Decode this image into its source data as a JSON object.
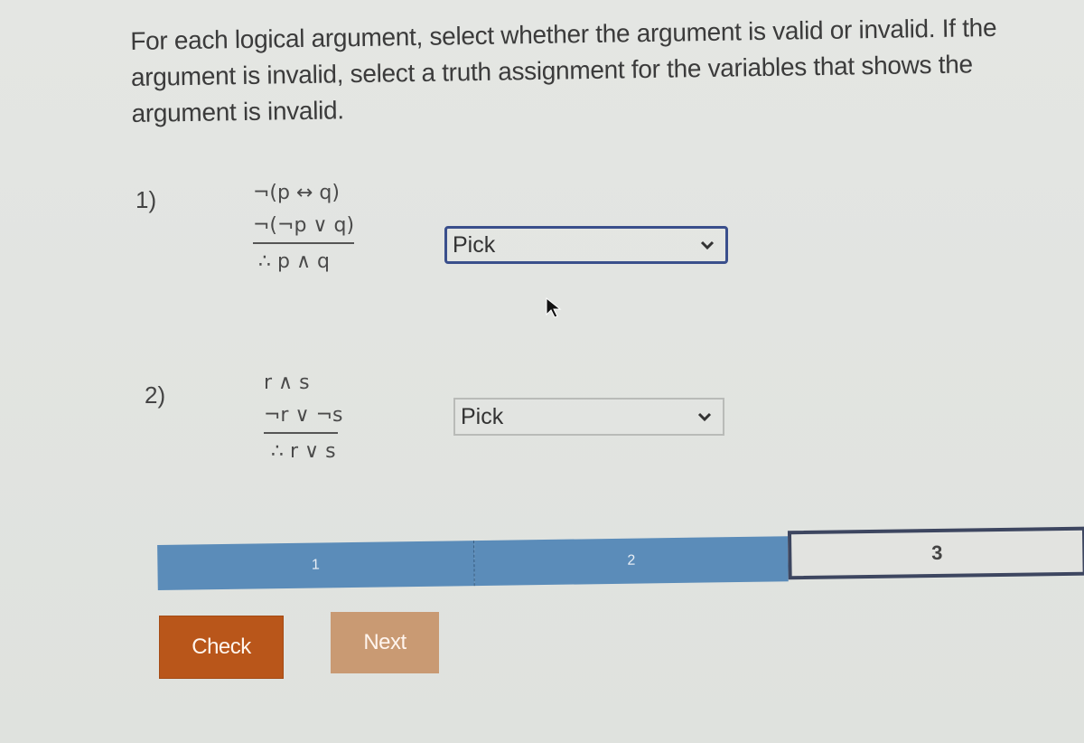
{
  "instructions": "For each logical argument, select whether the argument is valid or invalid. If the argument is invalid, select a truth assignment for the variables that shows the argument is invalid.",
  "questions": [
    {
      "number": "1)",
      "premises": [
        "¬(p ↔ q)",
        "¬(¬p ∨ q)"
      ],
      "conclusion": "∴ p ∧ q",
      "select_value": "Pick",
      "focused": true
    },
    {
      "number": "2)",
      "premises": [
        "r ∧ s",
        "¬r ∨ ¬s"
      ],
      "conclusion": "∴ r ∨ s",
      "select_value": "Pick",
      "focused": false
    }
  ],
  "progress": {
    "segments": [
      {
        "label": "1",
        "state": "completed"
      },
      {
        "label": "2",
        "state": "completed"
      },
      {
        "label": "3",
        "state": "current"
      }
    ]
  },
  "buttons": {
    "check": "Check",
    "next": "Next"
  },
  "colors": {
    "progress_fill": "#5b8cb9",
    "check_button": "#b9561a",
    "next_button": "#c99a73",
    "focus_border": "#3a4f8c"
  }
}
